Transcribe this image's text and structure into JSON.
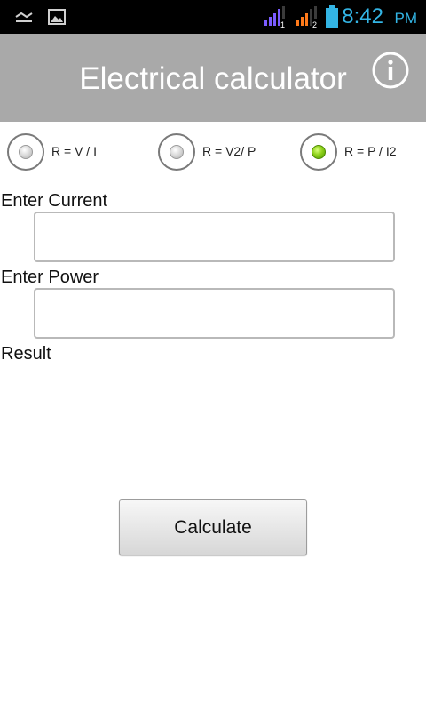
{
  "status_bar": {
    "time": "8:42",
    "ampm": "PM",
    "left_icons": [
      "notification-icon",
      "image-icon"
    ],
    "right_icons": [
      "signal-sim1-icon",
      "signal-sim2-icon",
      "battery-icon"
    ],
    "sim1_badge": "1",
    "sim2_badge": "2",
    "colors": {
      "time": "#33b5e5",
      "sim1": "#7b5cff",
      "sim2": "#ff7a1a",
      "battery": "#33b5e5"
    }
  },
  "header": {
    "title": "Electrical calculator",
    "info_icon": "info-icon",
    "background": "#a9a9a9"
  },
  "formula_options": [
    {
      "label": "R = V / I",
      "checked": false
    },
    {
      "label": "R = V2/ P",
      "checked": false
    },
    {
      "label": "R = P / I2",
      "checked": true
    }
  ],
  "form": {
    "current_label": "Enter Current",
    "current_value": "",
    "power_label": "Enter Power",
    "power_value": "",
    "result_label": "Result",
    "calculate_label": "Calculate"
  }
}
